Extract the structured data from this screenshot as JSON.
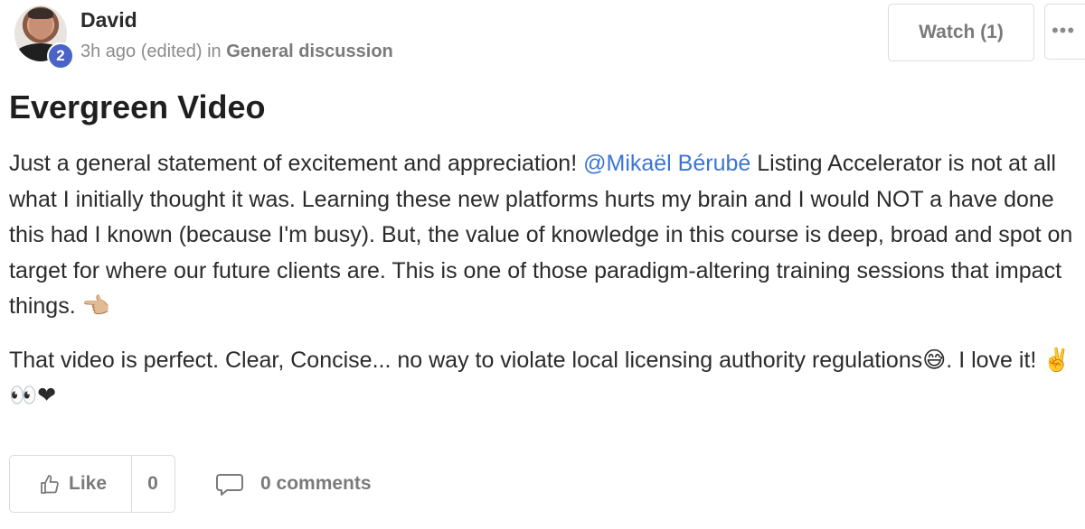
{
  "post": {
    "author": "David",
    "level_badge": "2",
    "time": "3h ago",
    "edited": "(edited)",
    "in_word": "in",
    "category": "General discussion",
    "title": "Evergreen Video",
    "body_part1": "Just a general statement of excitement and appreciation! ",
    "mention": "@Mikaël Bérubé",
    "body_part2": " Listing Accelerator is not at all what I initially thought it was. Learning these new platforms hurts my brain and I would NOT a have done this had I known (because I'm busy). But, the value of knowledge in this course is deep, broad and spot on target for where our future clients are. This is one of those paradigm-altering training sessions that impact things. 👈🏼",
    "paragraph2": "That video is perfect. Clear, Concise... no way to violate local licensing authority regulations😅. I love it! ✌️👀❤"
  },
  "actions": {
    "watch_label": "Watch (1)",
    "more_label": "•••",
    "like_label": "Like",
    "like_count": "0",
    "comments_label": "0 comments"
  }
}
